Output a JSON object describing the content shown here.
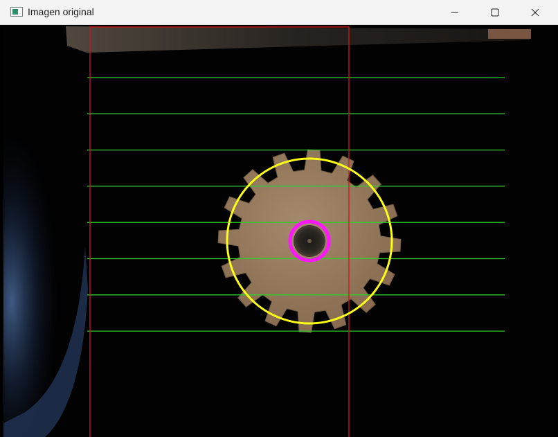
{
  "window": {
    "title": "Imagen original",
    "title_icon": "image-window-icon",
    "controls": {
      "minimize_icon": "minimize-icon",
      "maximize_icon": "maximize-icon",
      "close_icon": "close-icon"
    }
  },
  "overlay": {
    "roi_rectangle_color": "#d01818",
    "reference_lines_color": "#2ecc2e",
    "reference_lines_count": 8,
    "outer_circle_color": "#ffff18",
    "inner_circle_color": "#ff18ff",
    "gear_teeth_count": 16,
    "gear_color": "#9c8162"
  }
}
